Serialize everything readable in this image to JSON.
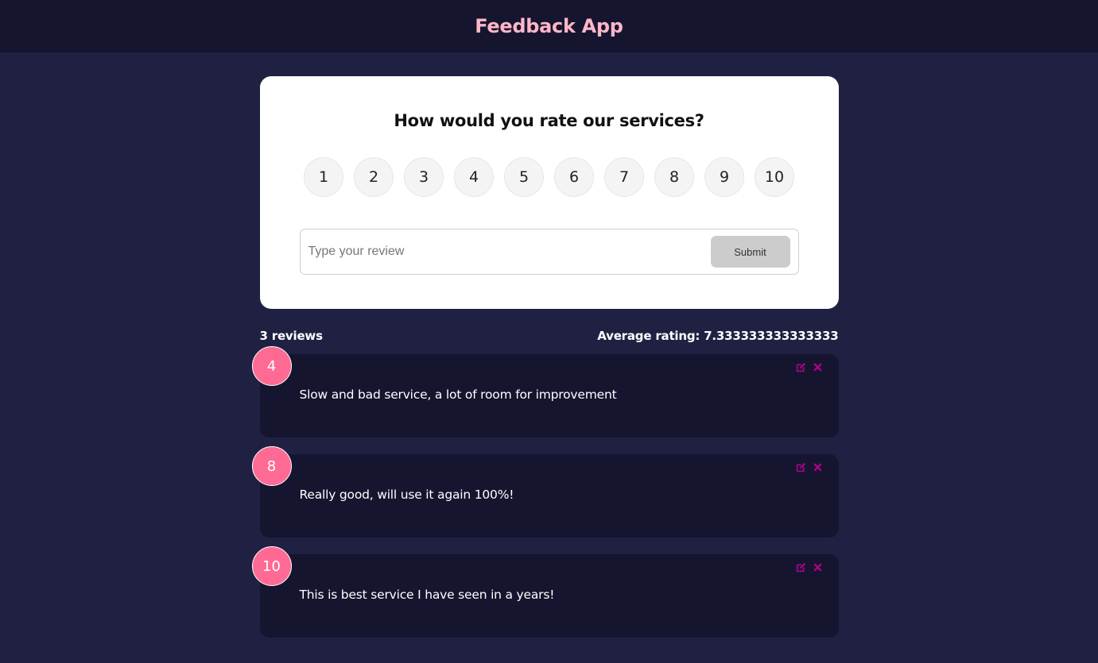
{
  "app": {
    "title": "Feedback App"
  },
  "rating_form": {
    "question": "How would you rate our services?",
    "options": [
      "1",
      "2",
      "3",
      "4",
      "5",
      "6",
      "7",
      "8",
      "9",
      "10"
    ],
    "input_placeholder": "Type your review",
    "input_value": "",
    "submit_label": "Submit"
  },
  "stats": {
    "review_count": "3 reviews",
    "average": "Average rating: 7.333333333333333"
  },
  "reviews": [
    {
      "rating": "4",
      "text": "Slow and bad service, a lot of room for improvement"
    },
    {
      "rating": "8",
      "text": "Really good, will use it again 100%!"
    },
    {
      "rating": "10",
      "text": "This is best service I have seen in a years!"
    }
  ],
  "colors": {
    "background": "#202142",
    "header": "#151530",
    "title": "#ffb6c8",
    "badge": "#ff6a95",
    "icon": "#b3008a"
  },
  "icons": {
    "edit": "edit-icon",
    "delete": "close-icon"
  }
}
